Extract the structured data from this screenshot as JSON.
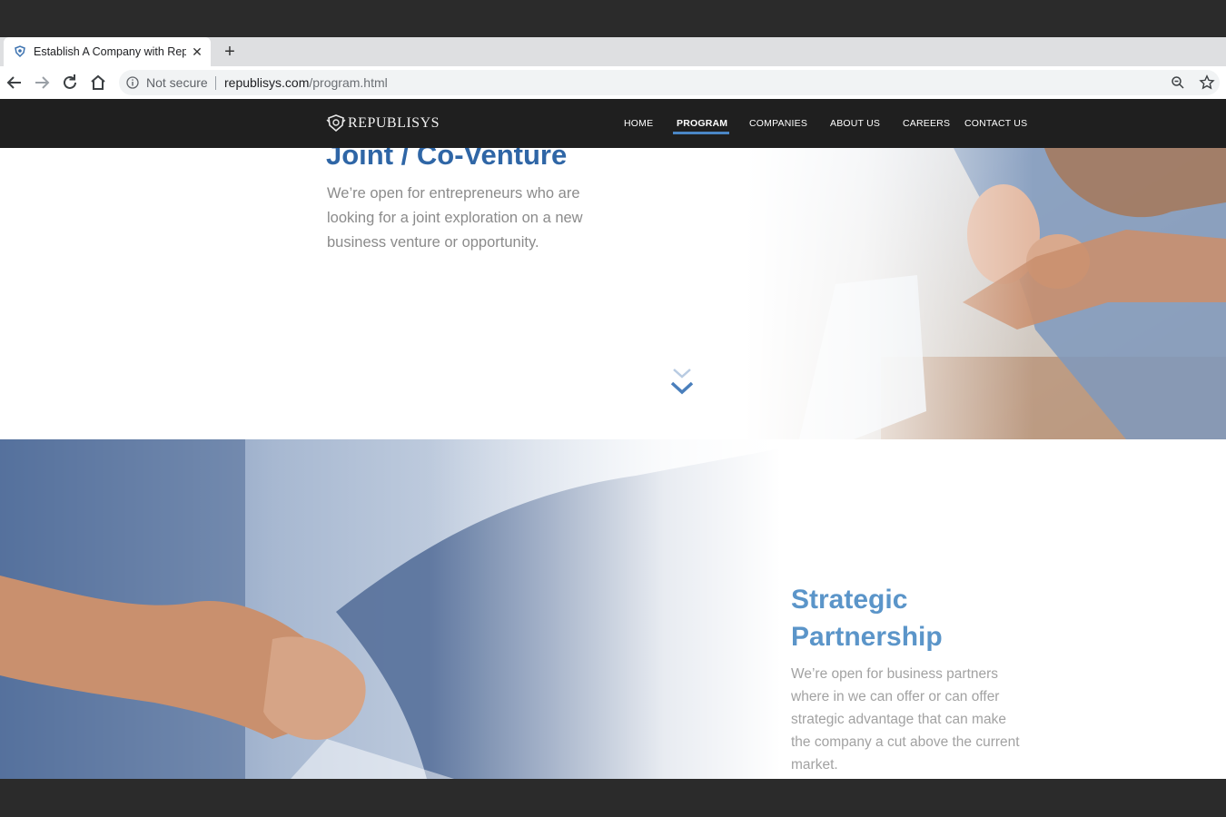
{
  "browser": {
    "tab_title": "Establish A Company with Republisys",
    "close_glyph": "✕",
    "new_tab_glyph": "+",
    "security_label": "Not secure",
    "url_host": "republisys.com",
    "url_path": "/program.html"
  },
  "site": {
    "logo_text": "REPUBLISYS",
    "nav": [
      {
        "label": "HOME"
      },
      {
        "label": "PROGRAM"
      },
      {
        "label": "COMPANIES"
      },
      {
        "label": "ABOUT US"
      },
      {
        "label": "CAREERS"
      },
      {
        "label": "CONTACT US"
      }
    ],
    "active_nav": "PROGRAM"
  },
  "sections": {
    "joint": {
      "title": "Joint / Co-Venture",
      "body": "We’re open for entrepreneurs who are looking for a joint exploration on a new business venture or opportunity."
    },
    "strategic": {
      "title": "Strategic Partnership",
      "body": "We’re open for business partners where in we can offer or can offer strategic advantage that can make the company a cut above the current market."
    }
  },
  "colors": {
    "nav_bg": "#1f1f1f",
    "accent": "#4a86c5",
    "title_blue": "#2f66a6",
    "title_blue_light": "#5b95c9",
    "body_gray": "#8b8b8b"
  },
  "icons": {
    "favicon": "shield-logo-icon",
    "back": "arrow-left-icon",
    "forward": "arrow-right-icon",
    "reload": "reload-icon",
    "home": "home-icon",
    "info": "info-icon",
    "zoom": "zoom-icon",
    "bookmark": "star-icon",
    "scroll": "double-chevron-down-icon"
  }
}
